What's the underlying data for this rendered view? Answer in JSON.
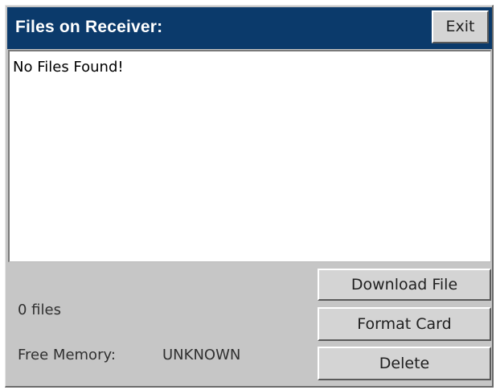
{
  "window": {
    "title": "Files on Receiver:",
    "exit_label": "Exit"
  },
  "file_list": {
    "empty_message": "No Files Found!"
  },
  "status": {
    "file_count": "0 files",
    "free_memory_label": "Free Memory:",
    "free_memory_value": "UNKNOWN"
  },
  "actions": {
    "download_label": "Download File",
    "format_label": "Format Card",
    "delete_label": "Delete"
  },
  "colors": {
    "titlebar": "#0b3a6b",
    "panel": "#c6c6c6",
    "button_face": "#d4d4d4"
  }
}
